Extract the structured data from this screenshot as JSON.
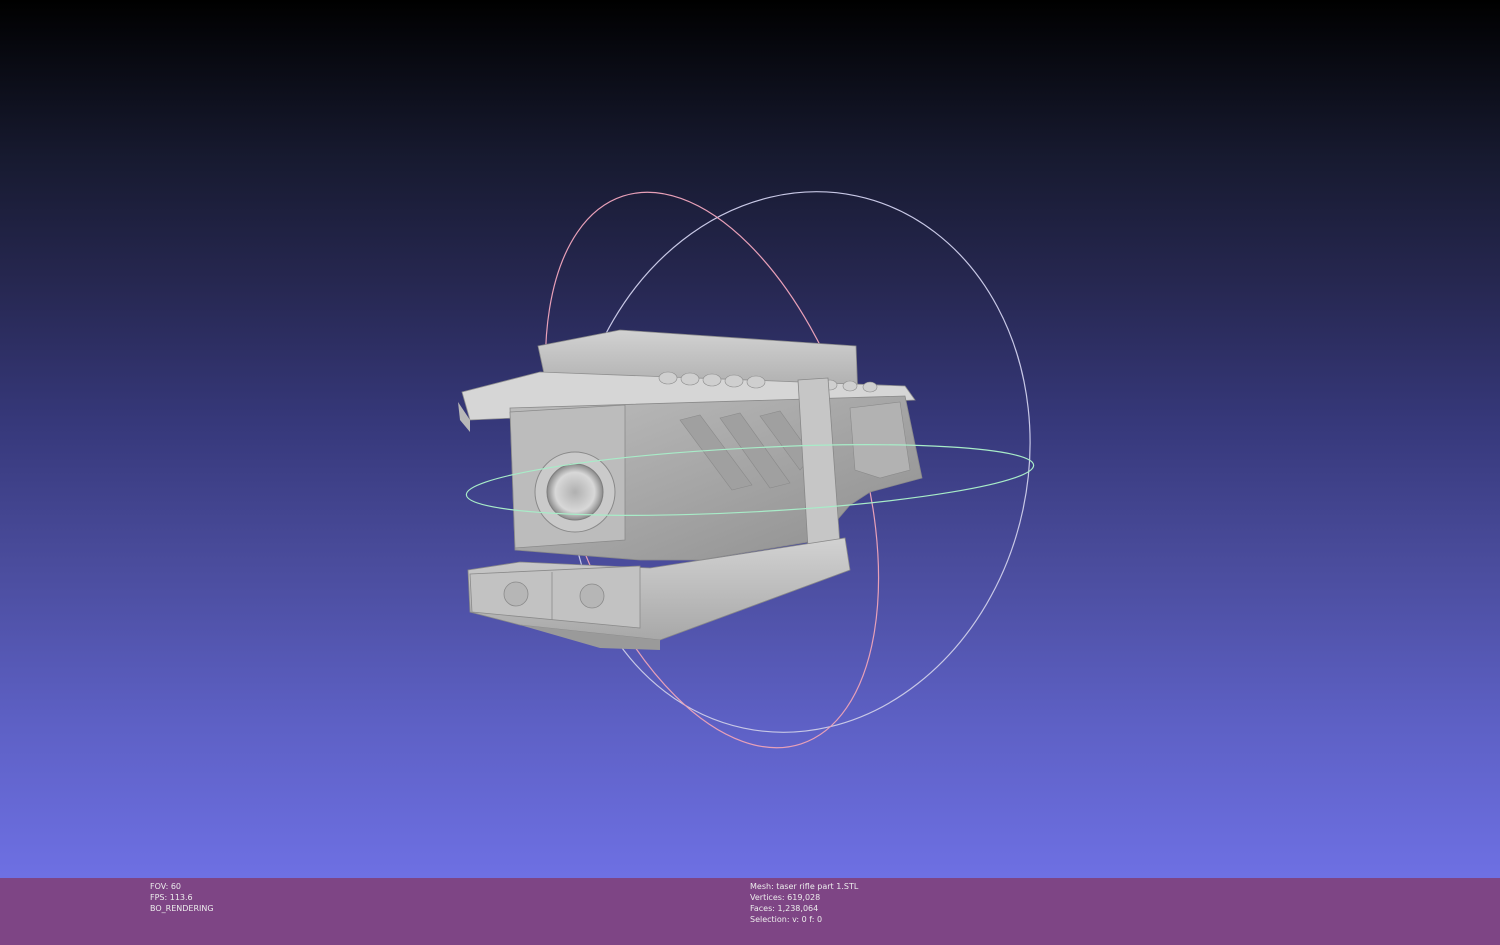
{
  "viewport": {
    "background_top": "#000000",
    "background_bottom": "#7072e6",
    "trackball_colors": {
      "vertical_ring": "#e8a0b8",
      "tilted_ring": "#c8c8e6",
      "horizontal_ring": "#a8ecc8"
    },
    "model_color": "#b4b4b4"
  },
  "status_bar": {
    "color": "#7e4585",
    "left": {
      "fov": "FOV: 60",
      "fps": "FPS:   113.6",
      "mode": "BO_RENDERING"
    },
    "right": {
      "mesh": "Mesh: taser rifle part 1.STL",
      "vertices": "Vertices: 619,028",
      "faces": "Faces: 1,238,064",
      "selection": "Selection: v: 0 f: 0"
    }
  }
}
